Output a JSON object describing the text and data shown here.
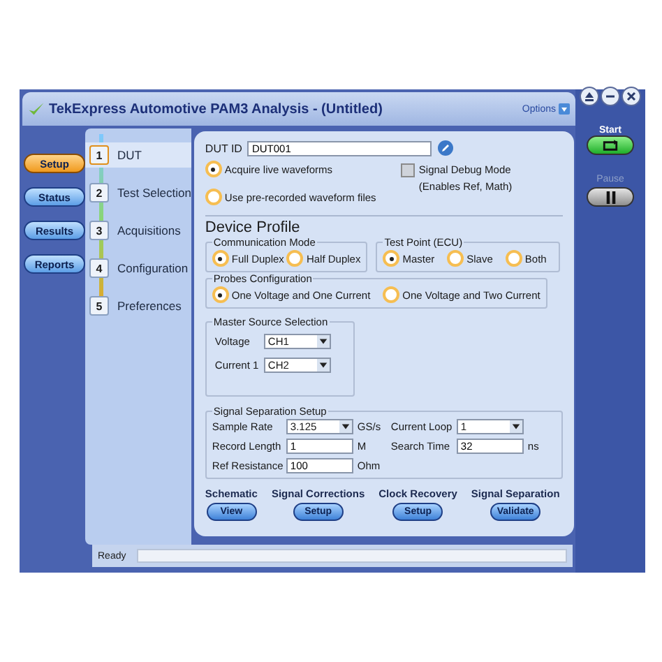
{
  "window": {
    "title": "TekExpress Automotive PAM3 Analysis  -  (Untitled)",
    "options_label": "Options"
  },
  "nav": [
    {
      "label": "Setup",
      "selected": true
    },
    {
      "label": "Status",
      "selected": false
    },
    {
      "label": "Results",
      "selected": false
    },
    {
      "label": "Reports",
      "selected": false
    }
  ],
  "steps": [
    {
      "number": "1",
      "label": "DUT",
      "selected": true
    },
    {
      "number": "2",
      "label": "Test Selection",
      "selected": false
    },
    {
      "number": "3",
      "label": "Acquisitions",
      "selected": false
    },
    {
      "number": "4",
      "label": "Configuration",
      "selected": false
    },
    {
      "number": "5",
      "label": "Preferences",
      "selected": false
    }
  ],
  "dut_id": {
    "label": "DUT ID",
    "value": "DUT001"
  },
  "source_options": [
    {
      "label": "Acquire live waveforms",
      "selected": true
    },
    {
      "label": "Use pre-recorded waveform files",
      "selected": false
    }
  ],
  "signal_debug": {
    "label": "Signal Debug Mode",
    "note": "(Enables Ref, Math)",
    "checked": false
  },
  "device_profile": {
    "title": "Device Profile",
    "communication_mode": {
      "title": "Communication Mode",
      "options": [
        {
          "label": "Full Duplex",
          "selected": true
        },
        {
          "label": "Half Duplex",
          "selected": false
        }
      ]
    },
    "test_point": {
      "title": "Test Point (ECU)",
      "options": [
        {
          "label": "Master",
          "selected": true
        },
        {
          "label": "Slave",
          "selected": false
        },
        {
          "label": "Both",
          "selected": false
        }
      ]
    },
    "probes": {
      "title": "Probes Configuration",
      "options": [
        {
          "label": "One Voltage and One Current",
          "selected": true
        },
        {
          "label": "One Voltage and Two Current",
          "selected": false
        }
      ]
    },
    "master_source": {
      "title": "Master Source Selection",
      "fields": [
        {
          "label": "Voltage",
          "value": "CH1"
        },
        {
          "label": "Current 1",
          "value": "CH2"
        }
      ]
    }
  },
  "signal_separation": {
    "title": "Signal Separation Setup",
    "fields": [
      {
        "label": "Sample Rate",
        "kind": "dropdown",
        "value": "3.125",
        "unit": "GS/s"
      },
      {
        "label": "Current Loop",
        "kind": "dropdown",
        "value": "1"
      },
      {
        "label": "Record Length",
        "kind": "text",
        "value": "1",
        "unit": "M"
      },
      {
        "label": "Search Time",
        "kind": "text",
        "value": "32",
        "unit": "ns"
      },
      {
        "label": "Ref Resistance",
        "kind": "text",
        "value": "100",
        "unit": "Ohm"
      }
    ]
  },
  "actions": [
    {
      "heading": "Schematic",
      "button": "View"
    },
    {
      "heading": "Signal Corrections",
      "button": "Setup"
    },
    {
      "heading": "Clock Recovery",
      "button": "Setup"
    },
    {
      "heading": "Signal Separation",
      "button": "Validate"
    }
  ],
  "run": {
    "start_label": "Start",
    "pause_label": "Pause",
    "pause_disabled": true
  },
  "status_bar": {
    "text": "Ready"
  }
}
